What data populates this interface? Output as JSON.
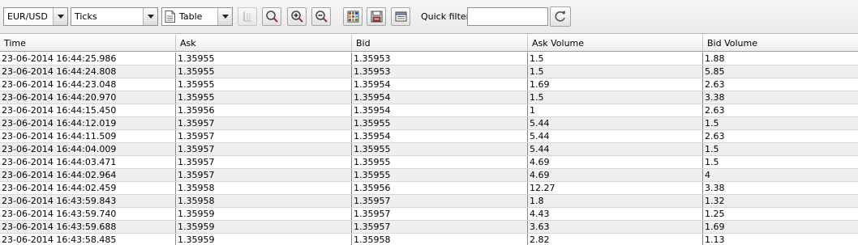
{
  "toolbar": {
    "instrument": "EUR/USD",
    "period": "Ticks",
    "view": "Table",
    "quick_filter_label": "Quick filter:",
    "quick_filter_value": ""
  },
  "table": {
    "columns": [
      "Time",
      "Ask",
      "Bid",
      "Ask Volume",
      "Bid Volume"
    ],
    "rows": [
      [
        "23-06-2014 16:44:25.986",
        "1.35955",
        "1.35953",
        "1.5",
        "1.88"
      ],
      [
        "23-06-2014 16:44:24.808",
        "1.35955",
        "1.35953",
        "1.5",
        "5.85"
      ],
      [
        "23-06-2014 16:44:23.048",
        "1.35955",
        "1.35954",
        "1.69",
        "2.63"
      ],
      [
        "23-06-2014 16:44:20.970",
        "1.35955",
        "1.35954",
        "1.5",
        "3.38"
      ],
      [
        "23-06-2014 16:44:15.450",
        "1.35956",
        "1.35954",
        "1",
        "2.63"
      ],
      [
        "23-06-2014 16:44:12.019",
        "1.35957",
        "1.35955",
        "5.44",
        "1.5"
      ],
      [
        "23-06-2014 16:44:11.509",
        "1.35957",
        "1.35954",
        "5.44",
        "2.63"
      ],
      [
        "23-06-2014 16:44:04.009",
        "1.35957",
        "1.35955",
        "5.44",
        "1.5"
      ],
      [
        "23-06-2014 16:44:03.471",
        "1.35957",
        "1.35955",
        "4.69",
        "1.5"
      ],
      [
        "23-06-2014 16:44:02.964",
        "1.35957",
        "1.35955",
        "4.69",
        "4"
      ],
      [
        "23-06-2014 16:44:02.459",
        "1.35958",
        "1.35956",
        "12.27",
        "3.38"
      ],
      [
        "23-06-2014 16:43:59.843",
        "1.35958",
        "1.35957",
        "1.8",
        "1.32"
      ],
      [
        "23-06-2014 16:43:59.740",
        "1.35959",
        "1.35957",
        "4.43",
        "1.25"
      ],
      [
        "23-06-2014 16:43:59.688",
        "1.35959",
        "1.35957",
        "3.63",
        "1.69"
      ],
      [
        "23-06-2014 16:43:58.485",
        "1.35959",
        "1.35958",
        "2.82",
        "1.13"
      ]
    ]
  },
  "icons": {
    "view": "table-view-icon",
    "first": "go-to-first-icon",
    "zoom_reset": "zoom-reset-icon",
    "zoom_in": "zoom-in-icon",
    "zoom_out": "zoom-out-icon",
    "grid": "grid-color-icon",
    "export": "export-icon",
    "settings": "table-settings-icon",
    "refresh": "refresh-icon"
  },
  "colors": {
    "row_alt": "#efefef",
    "toolbar_bg": "#ececec"
  }
}
